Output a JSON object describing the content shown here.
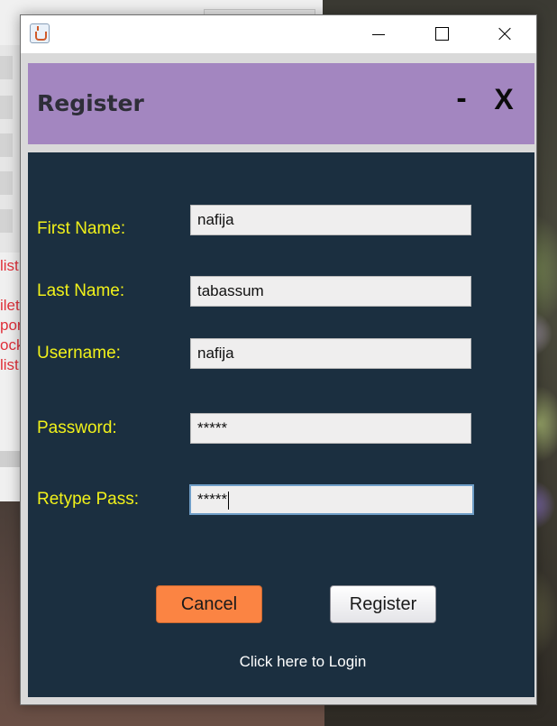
{
  "window": {
    "app_icon": "java-cup-icon",
    "controls": [
      "minimize-icon",
      "maximize-icon",
      "close-icon"
    ]
  },
  "header": {
    "title": "Register",
    "minimize_label": "-",
    "close_label": "X",
    "background_color": "#a386c0"
  },
  "form": {
    "background_color": "#1b2f40",
    "label_color": "#f1f11a",
    "fields": [
      {
        "label": "First Name:",
        "value": "nafija"
      },
      {
        "label": "Last Name:",
        "value": "tabassum"
      },
      {
        "label": "Username:",
        "value": "nafija"
      },
      {
        "label": "Password:",
        "value": "*****"
      },
      {
        "label": "Retype Pass:",
        "value": "*****"
      }
    ]
  },
  "buttons": {
    "cancel_label": "Cancel",
    "cancel_color": "#fb8443",
    "register_label": "Register"
  },
  "login_link": "Click here to Login",
  "background": {
    "left_window_text": "list\n\nilet\npor\nock\nlist"
  }
}
